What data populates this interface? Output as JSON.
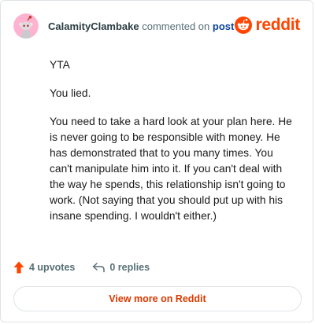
{
  "comment": {
    "author": "CalamityClambake",
    "action_text": "commented on",
    "target_link": "post",
    "brand_name": "reddit",
    "paragraphs": [
      "YTA",
      "You lied.",
      "You need to take a hard look at your plan here. He is never going to be responsible with money. He has demonstrated that to you many times. You can't manipulate him into it. If you can't deal with the way he spends, this relationship isn't going to work. (Not saying that you should put up with his insane spending. I wouldn't either.)"
    ]
  },
  "actions": {
    "upvotes_label": "4 upvotes",
    "replies_label": "0 replies"
  },
  "footer": {
    "view_more_label": "View more on Reddit"
  },
  "colors": {
    "brand": "#ff4500",
    "upvote": "#ff4500",
    "link": "#0a449b",
    "view_more": "#d93a00",
    "avatar_bg": "#ffb3d0"
  },
  "icons": {
    "avatar": "snoo-avatar",
    "brand": "reddit-logo-icon",
    "upvote": "upvote-arrow-icon",
    "reply": "reply-arrow-icon"
  }
}
